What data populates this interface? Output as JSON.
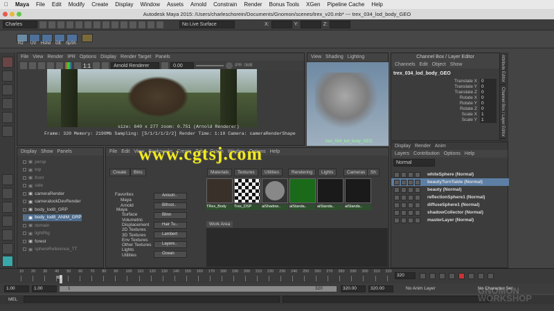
{
  "mac_menu": [
    "Maya",
    "File",
    "Edit",
    "Modify",
    "Create",
    "Display",
    "Window",
    "Assets",
    "Arnold",
    "Constrain",
    "Render",
    "Bonus Tools",
    "XGen",
    "Pipeline Cache",
    "Help"
  ],
  "window_title": "Autodesk Maya 2015: /Users/charleschorein/Documents/Gnomon/scenes/trex_v20.mb*  ---  trex_034_lod_body_GEO",
  "status": {
    "character": "Charles",
    "live_surface": "No Live Surface",
    "x_label": "X:",
    "y_label": "Y:",
    "z_label": "Z:"
  },
  "shelf": [
    "R2",
    "UV",
    "Hshd",
    "GE",
    "SpSh"
  ],
  "render_view": {
    "menu": [
      "File",
      "View",
      "Render",
      "IPR",
      "Options",
      "Display",
      "Render Target",
      "Panels"
    ],
    "ratio": "1:1",
    "renderer": "Arnold Renderer",
    "exposure": "0.00",
    "ipr": "IPR: 0MB",
    "info_line1": "size: 640 x 277  zoom: 0.751    (Arnold Renderer)",
    "info_line2": "Frame: 320   Memory: 2190Mb   Sampling: [5/1/1/1/2/2]   Render Time: 1:10   Camera: cameraRenderShape"
  },
  "viewport": {
    "menu": [
      "View",
      "Shading",
      "Lighting"
    ],
    "label": "trex_034_lod_body_GEO"
  },
  "channel_box": {
    "title": "Channel Box / Layer Editor",
    "menu": [
      "Channels",
      "Edit",
      "Object",
      "Show"
    ],
    "object": "trex_034_lod_body_GEO",
    "attrs": [
      {
        "name": "Translate X",
        "value": "0"
      },
      {
        "name": "Translate Y",
        "value": "0"
      },
      {
        "name": "Translate Z",
        "value": "0"
      },
      {
        "name": "Rotate X",
        "value": "0"
      },
      {
        "name": "Rotate Y",
        "value": "0"
      },
      {
        "name": "Rotate Z",
        "value": "0"
      },
      {
        "name": "Scale X",
        "value": "1"
      },
      {
        "name": "Scale Y",
        "value": "1"
      }
    ]
  },
  "side_tabs": [
    "Attribute Editor",
    "Channel Box / Layer Editor"
  ],
  "layers": {
    "tabs": [
      "Display",
      "Render",
      "Anim"
    ],
    "menu": [
      "Layers",
      "Contribution",
      "Options",
      "Help"
    ],
    "mode": "Normal",
    "items": [
      "whiteSphere (Normal)",
      "beautyTurnTable (Normal)",
      "beauty (Normal)",
      "reflectionSphere1 (Normal)",
      "diffuseSphere1 (Normal)",
      "shadowCollector (Normal)",
      "masterLayer (Normal)"
    ]
  },
  "outliner": {
    "menu": [
      "Display",
      "Show",
      "Panels"
    ],
    "items": [
      "persp",
      "top",
      "front",
      "side",
      "cameraRender",
      "cameralookDevRender",
      "body_lod8_GRP",
      "body_lod8_ANIM_GRP",
      "domain",
      "lightRig",
      "forest",
      "sphereReference_TT"
    ]
  },
  "hypershade": {
    "menu": [
      "File",
      "Edit",
      "View",
      "Bookmarks",
      "Create",
      "Tabs",
      "Graph",
      "Window",
      "Options",
      "Help"
    ],
    "tabs_left": [
      "Create",
      "Bins"
    ],
    "tabs_right": [
      "Materials",
      "Textures",
      "Utilities",
      "Rendering",
      "Lights",
      "Cameras",
      "Sh"
    ],
    "favorites": [
      "Favorites",
      "Maya",
      "Arnold"
    ],
    "categories": [
      "Maya",
      "Surface",
      "Volumetric",
      "Displacement",
      "2D Textures",
      "3D Textures",
      "Env Textures",
      "Other Textures",
      "Lights",
      "Utilities"
    ],
    "nodes": [
      "Anisotr..",
      "Bifrost..",
      "Blinn",
      "Hair Tu..",
      "Lambert",
      "Layere..",
      "Ocean"
    ],
    "swatches": [
      "TRex_Body",
      "Trex_DSP",
      "aiShadow..",
      "aiStanda..",
      "aiStanda..",
      "aiStanda.."
    ],
    "work_area": "Work Area"
  },
  "watermark": "www.cgtsj.com",
  "timeline": {
    "ticks": [
      "10",
      "20",
      "30",
      "40",
      "50",
      "60",
      "70",
      "80",
      "90",
      "100",
      "110",
      "120",
      "130",
      "140",
      "150",
      "160",
      "170",
      "180",
      "190",
      "200",
      "210",
      "220",
      "230",
      "240",
      "250",
      "260",
      "270",
      "280",
      "290",
      "300",
      "310",
      "320"
    ],
    "current": "82",
    "end": "320",
    "start_field": "1.00",
    "start_field2": "1.00",
    "frame_field": "1",
    "range_end": "320",
    "range_end2": "320.00",
    "range_end3": "320.00",
    "anim_layer": "No Anim Layer",
    "char_set": "No Character Set"
  },
  "cmd_label": "MEL",
  "brand_watermark": "GNOMON WORKSHOP"
}
